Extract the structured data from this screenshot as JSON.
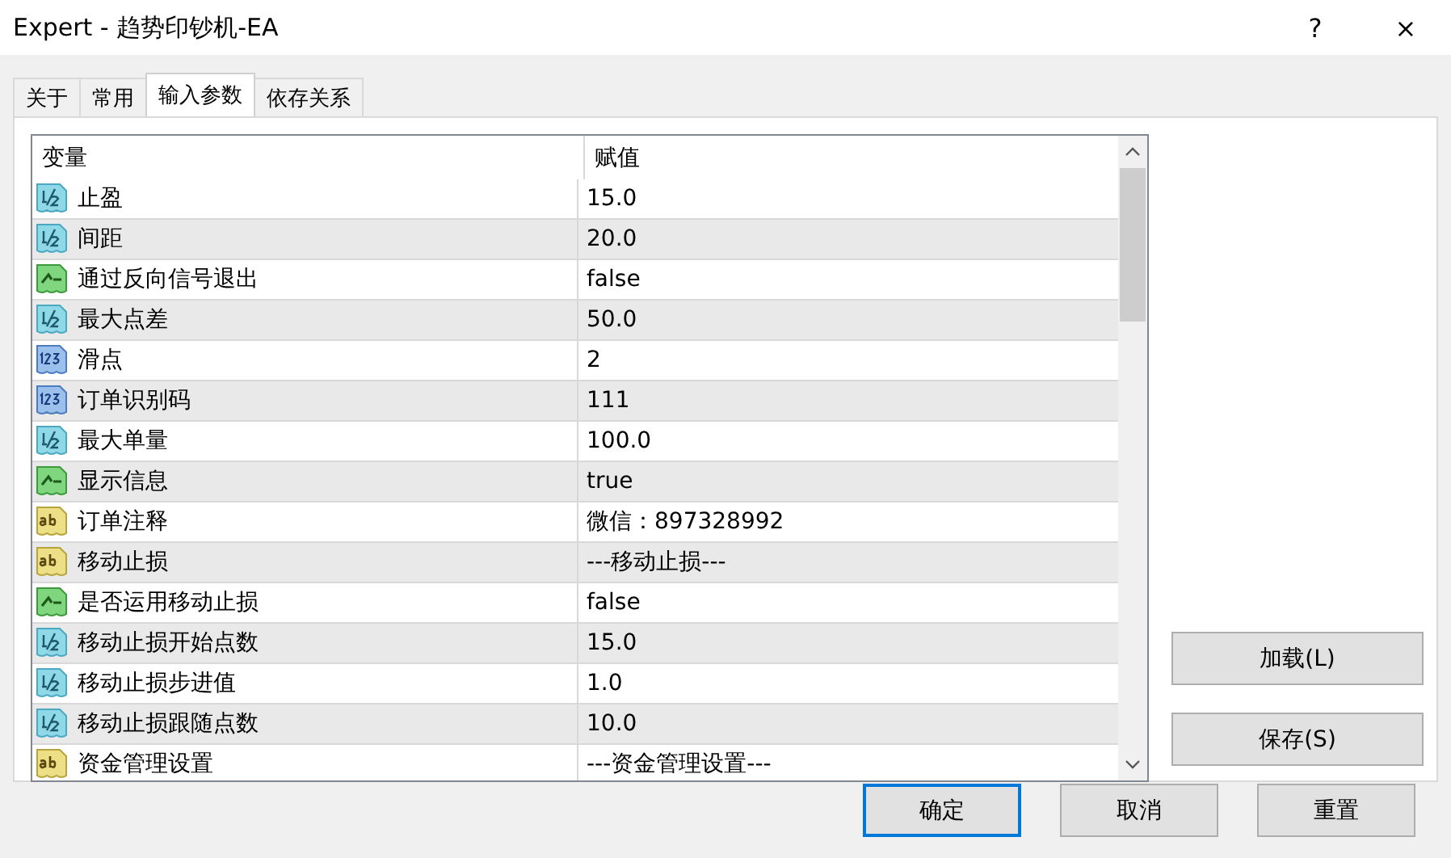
{
  "window": {
    "title": "Expert - 趋势印钞机-EA",
    "help": "?",
    "close": "×"
  },
  "tabs": [
    {
      "label": "关于",
      "selected": false
    },
    {
      "label": "常用",
      "selected": false
    },
    {
      "label": "输入参数",
      "selected": true
    },
    {
      "label": "依存关系",
      "selected": false
    }
  ],
  "table": {
    "columns": [
      "变量",
      "赋值"
    ],
    "rows": [
      {
        "kind": "double",
        "name": "止盈",
        "value": "15.0"
      },
      {
        "kind": "double",
        "name": "间距",
        "value": "20.0"
      },
      {
        "kind": "bool",
        "name": "通过反向信号退出",
        "value": "false"
      },
      {
        "kind": "double",
        "name": "最大点差",
        "value": "50.0"
      },
      {
        "kind": "int",
        "name": "滑点",
        "value": "2"
      },
      {
        "kind": "int",
        "name": "订单识别码",
        "value": "111"
      },
      {
        "kind": "double",
        "name": "最大单量",
        "value": "100.0"
      },
      {
        "kind": "bool",
        "name": "显示信息",
        "value": "true"
      },
      {
        "kind": "string",
        "name": "订单注释",
        "value": "微信：897328992"
      },
      {
        "kind": "string",
        "name": "移动止损",
        "value": "---移动止损---"
      },
      {
        "kind": "bool",
        "name": "是否运用移动止损",
        "value": "false"
      },
      {
        "kind": "double",
        "name": "移动止损开始点数",
        "value": "15.0"
      },
      {
        "kind": "double",
        "name": "移动止损步进值",
        "value": "1.0"
      },
      {
        "kind": "double",
        "name": "移动止损跟随点数",
        "value": "10.0"
      },
      {
        "kind": "string",
        "name": "资金管理设置",
        "value": "---资金管理设置---"
      }
    ]
  },
  "side_buttons": [
    "加载(L)",
    "保存(S)"
  ],
  "buttons": [
    {
      "label": "确定",
      "default": true
    },
    {
      "label": "取消",
      "default": false
    },
    {
      "label": "重置",
      "default": false
    }
  ]
}
